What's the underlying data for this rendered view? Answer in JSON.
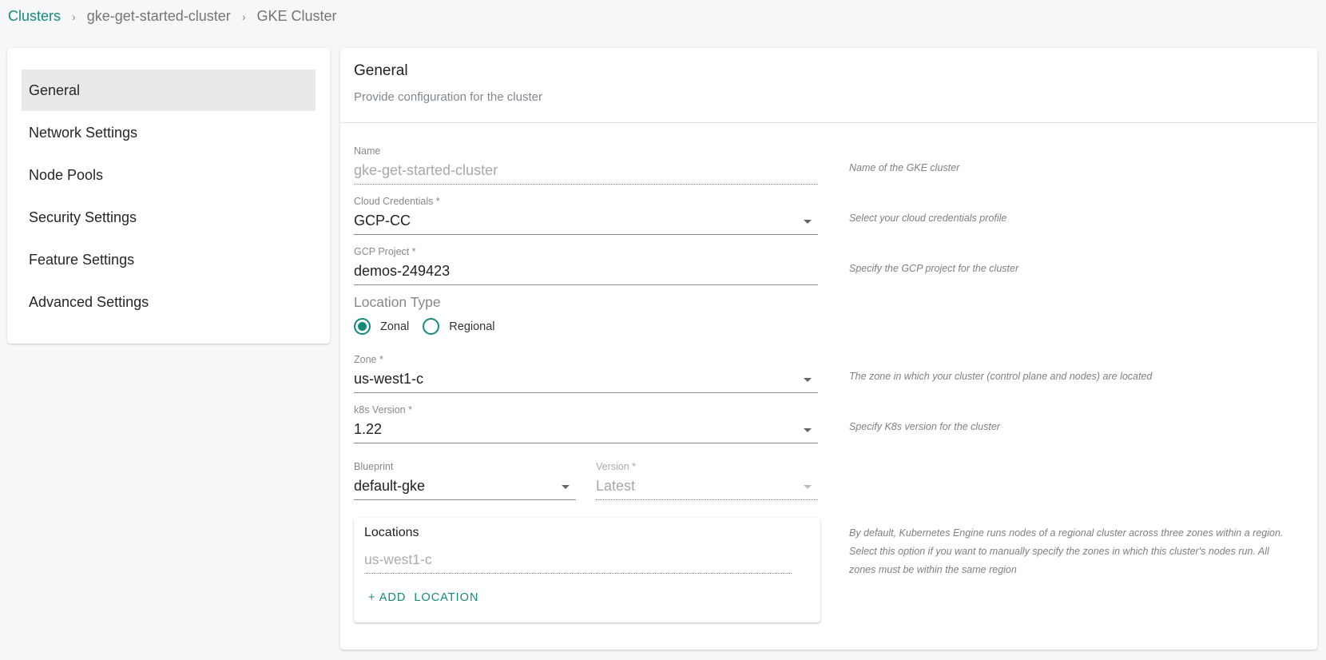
{
  "breadcrumb": {
    "items": [
      "Clusters",
      "gke-get-started-cluster",
      "GKE Cluster"
    ],
    "separator": "›"
  },
  "sidebar": {
    "items": [
      {
        "label": "General",
        "active": true
      },
      {
        "label": "Network Settings"
      },
      {
        "label": "Node Pools"
      },
      {
        "label": "Security Settings"
      },
      {
        "label": "Feature Settings"
      },
      {
        "label": "Advanced Settings"
      }
    ]
  },
  "main": {
    "title": "General",
    "subtitle": "Provide configuration for the cluster"
  },
  "form": {
    "name": {
      "label": "Name",
      "value": "gke-get-started-cluster",
      "help": "Name of the GKE cluster"
    },
    "cloud_credentials": {
      "label": "Cloud Credentials *",
      "value": "GCP-CC",
      "help": "Select your cloud credentials profile"
    },
    "gcp_project": {
      "label": "GCP Project *",
      "value": "demos-249423",
      "help": "Specify the GCP project for the cluster"
    },
    "location_type": {
      "label": "Location Type",
      "options": [
        "Zonal",
        "Regional"
      ],
      "selected": "Zonal"
    },
    "zone": {
      "label": "Zone *",
      "value": "us-west1-c",
      "help": "The zone in which your cluster (control plane and nodes) are located"
    },
    "k8s_version": {
      "label": "k8s Version *",
      "value": "1.22",
      "help": "Specify K8s version for the cluster"
    },
    "blueprint": {
      "label": "Blueprint",
      "value": "default-gke"
    },
    "blueprint_version": {
      "label": "Version *",
      "value": "Latest"
    },
    "locations": {
      "title": "Locations",
      "value": "us-west1-c",
      "add_button": "+ ADD  LOCATION",
      "help": "By default, Kubernetes Engine runs nodes of a regional cluster across three zones within a region. Select this option if you want to manually specify the zones in which this cluster's nodes run. All zones must be within the same region"
    }
  },
  "colors": {
    "accent": "#148b7a",
    "background": "#f6f7f9",
    "active_nav": "#e9e9e9"
  }
}
